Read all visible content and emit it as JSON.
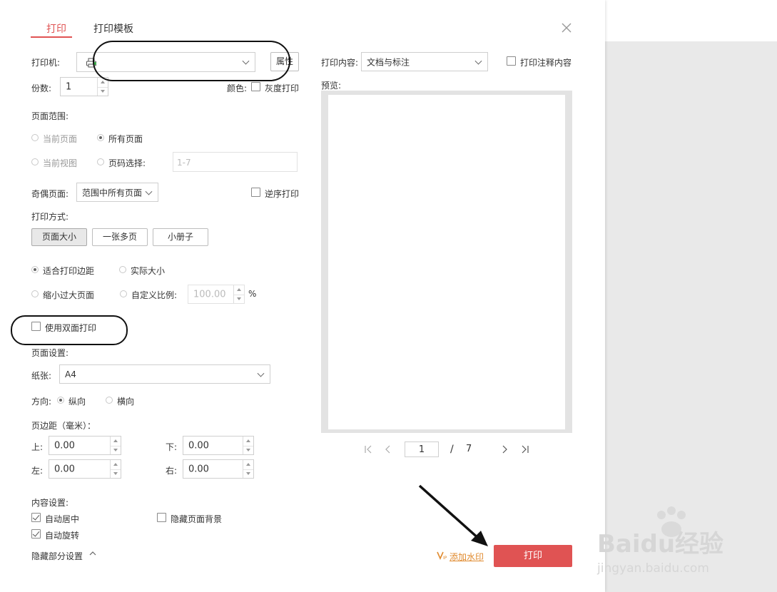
{
  "tabs": [
    {
      "label": "打印",
      "active": true
    },
    {
      "label": "打印模板",
      "active": false
    }
  ],
  "colors": {
    "accent": "#e05353",
    "link": "#e08a2e"
  },
  "printer": {
    "label": "打印机:",
    "value": "",
    "properties_button": "属性"
  },
  "copies": {
    "label": "份数:",
    "value": "1"
  },
  "color_mode": {
    "label": "颜色:",
    "grayscale_label": "灰度打印",
    "grayscale_checked": false
  },
  "page_range": {
    "title": "页面范围:",
    "current_page": "当前页面",
    "all_pages": "所有页面",
    "current_view": "当前视图",
    "page_select": "页码选择:",
    "page_select_placeholder": "1-7",
    "selected": "all_pages"
  },
  "odd_even": {
    "label": "奇偶页面:",
    "value": "范围中所有页面"
  },
  "reverse": {
    "label": "逆序打印",
    "checked": false
  },
  "print_mode": {
    "title": "打印方式:",
    "options": [
      "页面大小",
      "一张多页",
      "小册子"
    ],
    "selected": "页面大小"
  },
  "scaling": {
    "fit_margins": "适合打印边距",
    "actual_size": "实际大小",
    "shrink_large": "缩小过大页面",
    "custom_scale": "自定义比例:",
    "custom_value": "100.00",
    "percent": "%",
    "selected": "fit_margins"
  },
  "duplex": {
    "label": "使用双面打印",
    "checked": false
  },
  "page_setup": {
    "title": "页面设置:",
    "paper_label": "纸张:",
    "paper_value": "A4",
    "orientation_label": "方向:",
    "portrait": "纵向",
    "landscape": "横向",
    "orientation_selected": "portrait"
  },
  "margins": {
    "title": "页边距（毫米）：",
    "top_label": "上:",
    "top_value": "0.00",
    "bottom_label": "下:",
    "bottom_value": "0.00",
    "left_label": "左:",
    "left_value": "0.00",
    "right_label": "右:",
    "right_value": "0.00"
  },
  "content_settings": {
    "title": "内容设置:",
    "auto_center": "自动居中",
    "auto_center_checked": true,
    "hide_background": "隐藏页面背景",
    "hide_background_checked": false,
    "auto_rotate": "自动旋转",
    "auto_rotate_checked": true,
    "hide_some": "隐藏部分设置"
  },
  "print_content": {
    "label": "打印内容:",
    "value": "文档与标注",
    "annotations_label": "打印注释内容",
    "annotations_checked": false
  },
  "preview": {
    "label": "预览:",
    "current_page": "1",
    "separator": "/",
    "total_pages": "7"
  },
  "footer": {
    "add_watermark": "添加水印",
    "print_button": "打印"
  },
  "watermark_brand": {
    "text": "Baidu经验",
    "url_text": "jingyan.baidu.com"
  }
}
